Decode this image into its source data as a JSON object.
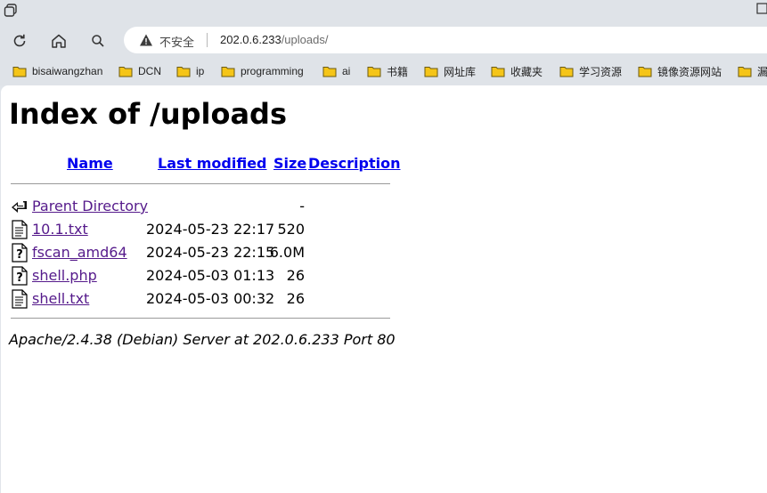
{
  "browser": {
    "tab_icon": "tabs-icon",
    "window_control_icon": "maximize-icon",
    "toolbar": {
      "reload_icon": "reload-icon",
      "home_icon": "home-icon",
      "search_icon": "search-icon"
    },
    "address_bar": {
      "security_icon": "warning-triangle-icon",
      "security_label": "不安全",
      "url_host": "202.0.6.233",
      "url_path": "/uploads/"
    },
    "bookmarks": [
      {
        "label": "bisaiwangzhan"
      },
      {
        "label": "DCN"
      },
      {
        "label": "ip"
      },
      {
        "label": "programming"
      },
      {
        "label": "ai"
      },
      {
        "label": "书籍"
      },
      {
        "label": "网址库"
      },
      {
        "label": "收藏夹"
      },
      {
        "label": "学习资源"
      },
      {
        "label": "镜像资源网站"
      },
      {
        "label": "漏"
      }
    ],
    "bookmark_color": "#f5c518"
  },
  "page": {
    "title": "Index of /uploads",
    "columns": {
      "name": "Name",
      "last_modified": "Last modified",
      "size": "Size",
      "description": "Description"
    },
    "entries": [
      {
        "icon": "back-arrow-icon",
        "name": "Parent Directory",
        "modified": "",
        "size": "-"
      },
      {
        "icon": "text-file-icon",
        "name": "10.1.txt",
        "modified": "2024-05-23 22:17",
        "size": "520"
      },
      {
        "icon": "unknown-file-icon",
        "name": "fscan_amd64",
        "modified": "2024-05-23 22:15",
        "size": "6.0M"
      },
      {
        "icon": "unknown-file-icon",
        "name": "shell.php",
        "modified": "2024-05-03 01:13",
        "size": "26"
      },
      {
        "icon": "text-file-icon",
        "name": "shell.txt",
        "modified": "2024-05-03 00:32",
        "size": "26"
      }
    ],
    "footer": "Apache/2.4.38 (Debian) Server at 202.0.6.233 Port 80",
    "link_color": "#0000ee",
    "visited_link_color": "#551a8b"
  }
}
